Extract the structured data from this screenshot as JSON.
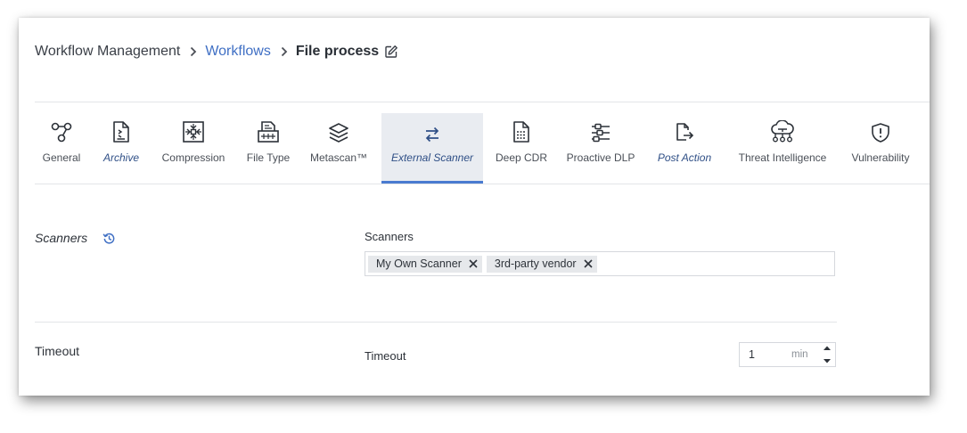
{
  "breadcrumb": {
    "root": "Workflow Management",
    "link": "Workflows",
    "current": "File process"
  },
  "tabs": [
    {
      "label": "General",
      "icon": "nodes-icon"
    },
    {
      "label": "Archive",
      "icon": "document-icon"
    },
    {
      "label": "Compression",
      "icon": "compress-icon"
    },
    {
      "label": "File Type",
      "icon": "file-type-icon"
    },
    {
      "label": "Metascan™",
      "icon": "layers-icon"
    },
    {
      "label": "External Scanner",
      "icon": "swap-icon",
      "active": true
    },
    {
      "label": "Deep CDR",
      "icon": "deep-cdr-icon"
    },
    {
      "label": "Proactive DLP",
      "icon": "dlp-icon"
    },
    {
      "label": "Post Action",
      "icon": "post-action-icon"
    },
    {
      "label": "Threat Intelligence",
      "icon": "cloud-network-icon"
    },
    {
      "label": "Vulnerability",
      "icon": "shield-icon"
    }
  ],
  "scanners_section": {
    "title": "Scanners",
    "field_label": "Scanners",
    "tags": [
      "My Own Scanner",
      "3rd-party vendor"
    ]
  },
  "timeout_section": {
    "title": "Timeout",
    "field_label": "Timeout",
    "value": "1",
    "unit": "min"
  },
  "colors": {
    "link": "#3f6fc4",
    "active_tab_bg": "#e9ecf1",
    "active_tab_border": "#4a7bd0",
    "icon_stroke": "#2c3138"
  }
}
